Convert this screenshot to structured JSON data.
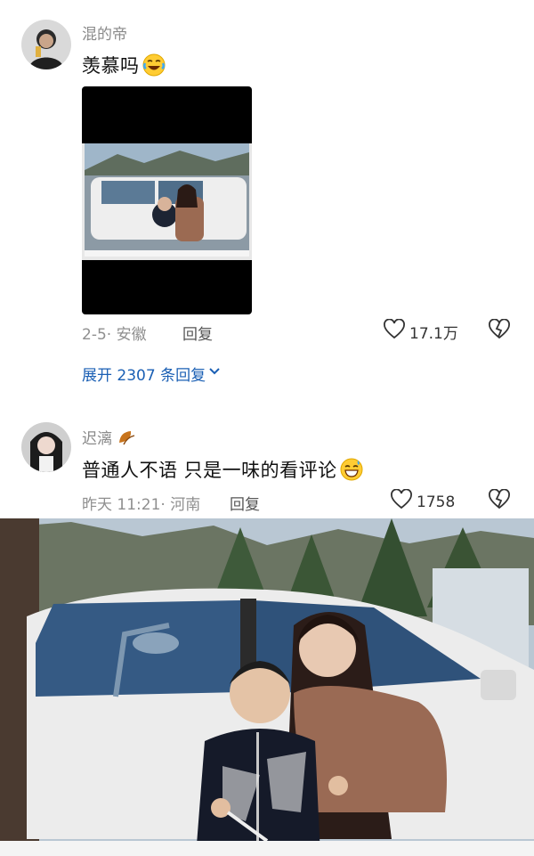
{
  "comments": [
    {
      "username": "混的帝",
      "text": "羡慕吗",
      "emoji": "laughing-tears-emoji",
      "meta": "2-5· 安徽",
      "reply_label": "回复",
      "likes": "17.1万",
      "expand_label": "展开 2307 条回复"
    },
    {
      "username": "迟漓",
      "username_badge": "leaf-badge-icon",
      "text": "普通人不语 只是一味的看评论",
      "emoji": "grinning-sweat-emoji",
      "meta": "昨天 11:21· 河南",
      "reply_label": "回复",
      "likes": "1758"
    }
  ],
  "colors": {
    "link": "#1a5fb4",
    "meta": "#8f8f8f",
    "username": "#8a8a8a"
  }
}
